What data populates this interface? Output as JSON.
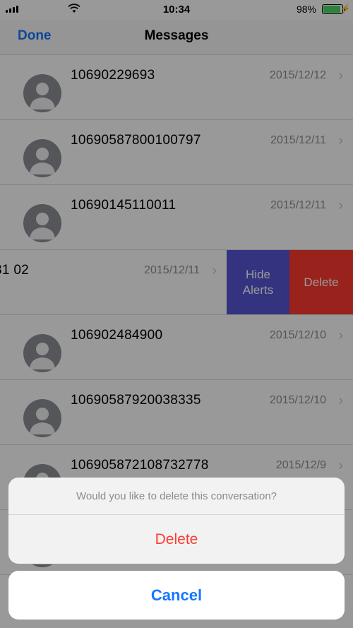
{
  "status_bar": {
    "time": "10:34",
    "battery_percent": "98%",
    "battery_level": 0.98,
    "battery_color": "#4cd964",
    "icons": [
      "signal-icon",
      "wifi-icon",
      "battery-icon",
      "charging-icon"
    ]
  },
  "nav": {
    "done_label": "Done",
    "title": "Messages",
    "accent_color": "#1677ff"
  },
  "messages": [
    {
      "sender": "10690229693",
      "date": "2015/12/12"
    },
    {
      "sender": "10690587800100797",
      "date": "2015/12/11"
    },
    {
      "sender": "10690145110011",
      "date": "2015/12/11"
    },
    {
      "sender": "31 02",
      "date": "2015/12/11",
      "swiped": true
    },
    {
      "sender": "106902484900",
      "date": "2015/12/10"
    },
    {
      "sender": "10690587920038335",
      "date": "2015/12/10"
    },
    {
      "sender": "10690587210873277​8",
      "date": "2015/12/9"
    }
  ],
  "swipe_actions": {
    "hide_alerts_label": "Hide\nAlerts",
    "delete_label": "Delete",
    "hide_color": "#5856d6",
    "delete_color": "#ff3b30"
  },
  "action_sheet": {
    "message": "Would you like to delete this conversation?",
    "delete_label": "Delete",
    "cancel_label": "Cancel"
  }
}
